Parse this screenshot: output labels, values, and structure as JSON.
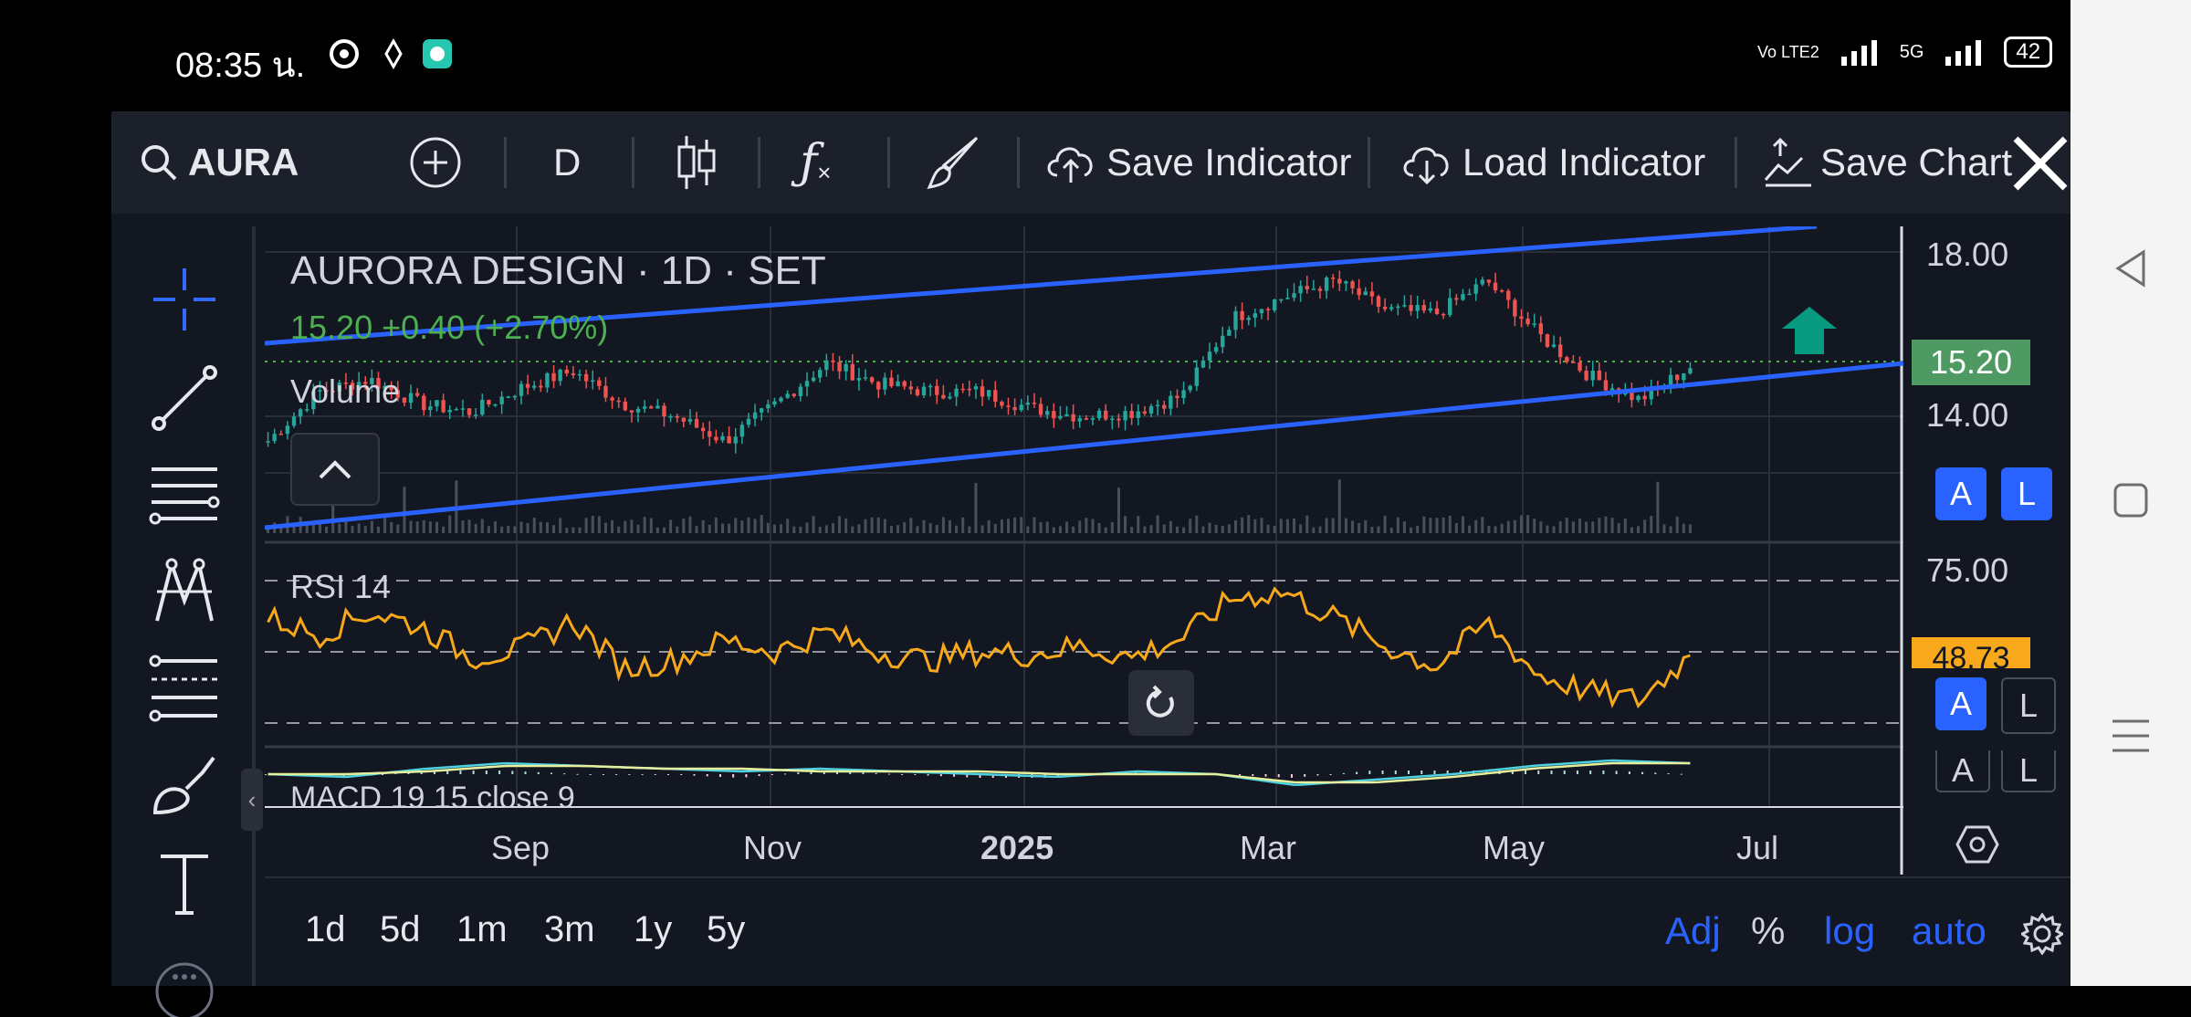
{
  "status_bar": {
    "time": "08:35 น.",
    "network_label": "Vo LTE2",
    "cell_label": "5G",
    "battery": "42"
  },
  "toolbar": {
    "symbol": "AURA",
    "interval": "D",
    "save_indicator": "Save Indicator",
    "load_indicator": "Load Indicator",
    "save_chart": "Save Chart"
  },
  "legend": {
    "title": "AURORA DESIGN · 1D · SET",
    "price_line": "15.20 +0.40 (+2.70%)",
    "volume": "Volume",
    "rsi": "RSI 14",
    "macd": "MACD 19 15 close 9"
  },
  "price_scale": {
    "labels": [
      "18.00",
      "14.00"
    ],
    "last_price": "15.20",
    "rsi_label": "75.00",
    "rsi_value": "48.73",
    "btn_a": "A",
    "btn_l": "L"
  },
  "time_axis": [
    "Sep",
    "Nov",
    "2025",
    "Mar",
    "May",
    "Jul"
  ],
  "ranges": [
    "1d",
    "5d",
    "1m",
    "3m",
    "1y",
    "5y"
  ],
  "options": {
    "adj": "Adj",
    "percent": "%",
    "log": "log",
    "auto": "auto"
  },
  "colors": {
    "background": "#131722",
    "toolbar": "#1c202b",
    "up": "#26a69a",
    "down": "#ef5350",
    "trendline": "#2962ff",
    "rsi": "#f7a81b",
    "accent_blue": "#2962ff",
    "last_price_bg": "#4f9a62"
  },
  "chart_data": {
    "type": "candlestick",
    "instrument": "AURORA DESIGN · 1D · SET",
    "x": [
      "Sep",
      "Nov",
      "2025",
      "Mar",
      "May",
      "Jul"
    ],
    "close": [
      13.4,
      14.6,
      14.9,
      14.3,
      14.1,
      14.7,
      15.1,
      14.3,
      14.0,
      13.4,
      14.3,
      15.3,
      14.8,
      14.6,
      14.6,
      14.2,
      14.0,
      14.1,
      14.5,
      16.4,
      16.9,
      17.3,
      16.6,
      16.5,
      17.3,
      16.0,
      15.0,
      14.4,
      15.2
    ],
    "last_close": 15.2,
    "change": 0.4,
    "change_pct": 2.7,
    "price_axis_labels": [
      18.0,
      14.0
    ],
    "rsi_period": 14,
    "rsi": [
      62,
      56,
      64,
      59,
      48,
      51,
      61,
      44,
      47,
      54,
      50,
      57,
      50,
      47,
      50,
      49,
      52,
      48,
      55,
      69,
      71,
      62,
      52,
      45,
      60,
      42,
      36,
      33,
      48.73
    ],
    "rsi_upper": 75,
    "rsi_mid": 50,
    "rsi_lower": 25,
    "macd_params": "MACD 19 15 close 9",
    "marker": "green up arrow"
  }
}
